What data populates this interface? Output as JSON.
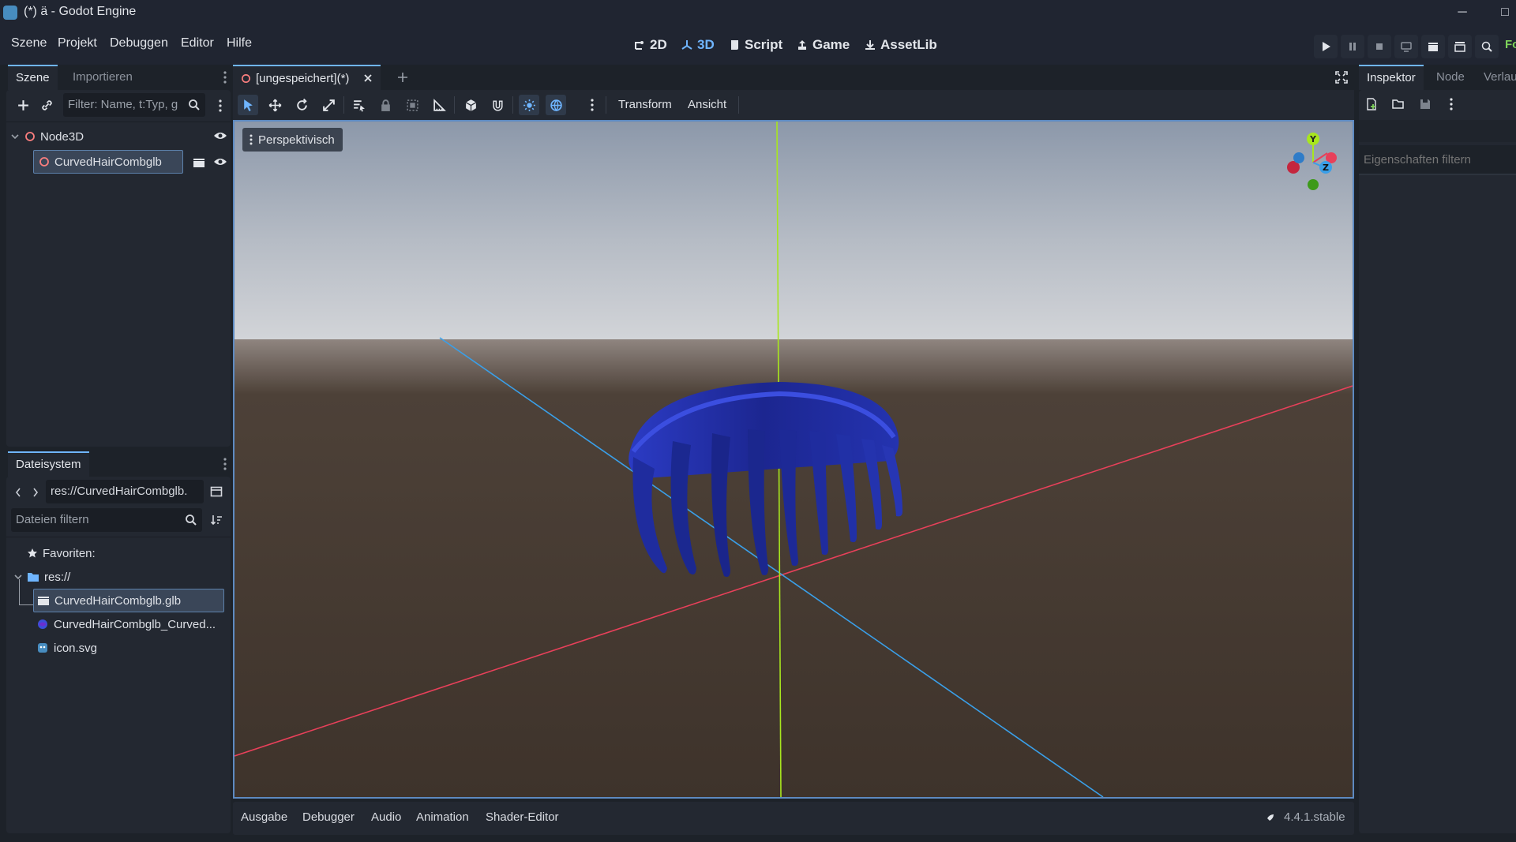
{
  "window": {
    "title": "(*) ä - Godot Engine",
    "minimize_glyph": "─",
    "maximize_glyph": "□"
  },
  "menu": {
    "items": [
      "Szene",
      "Projekt",
      "Debuggen",
      "Editor",
      "Hilfe"
    ]
  },
  "workspaces": {
    "tabs": [
      {
        "label": "2D",
        "icon": "2d-icon",
        "active": false
      },
      {
        "label": "3D",
        "icon": "3d-icon",
        "active": true
      },
      {
        "label": "Script",
        "icon": "script-icon",
        "active": false
      },
      {
        "label": "Game",
        "icon": "game-icon",
        "active": false
      },
      {
        "label": "AssetLib",
        "icon": "assetlib-icon",
        "active": false
      }
    ]
  },
  "run_controls": {
    "truncated_label": "Fo"
  },
  "scene_dock": {
    "tabs": [
      "Szene",
      "Importieren"
    ],
    "filter_placeholder": "Filter: Name, t:Typ, g",
    "nodes": [
      {
        "name": "Node3D",
        "type": "node3d-icon"
      },
      {
        "name": "CurvedHairCombglb",
        "type": "node3d-icon"
      }
    ]
  },
  "filesystem_dock": {
    "tab": "Dateisystem",
    "path": "res://CurvedHairCombglb.",
    "filter_placeholder": "Dateien filtern",
    "favorites": "Favoriten:",
    "root": "res://",
    "files": [
      {
        "name": "CurvedHairCombglb.glb",
        "icon": "scene-file-icon",
        "selected": true
      },
      {
        "name": "CurvedHairCombglb_Curved...",
        "icon": "material-file-icon",
        "selected": false
      },
      {
        "name": "icon.svg",
        "icon": "image-file-icon",
        "selected": false
      }
    ]
  },
  "editor": {
    "scene_tab": "[ungespeichert](*)",
    "toolbar_menus": [
      "Transform",
      "Ansicht"
    ],
    "viewport_mode": "Perspektivisch",
    "gizmo_labels": {
      "y": "Y",
      "z": "Z"
    }
  },
  "bottom_panel": {
    "tabs": [
      "Ausgabe",
      "Debugger",
      "Audio",
      "Animation",
      "Shader-Editor"
    ],
    "version": "4.4.1.stable"
  },
  "inspector_dock": {
    "tabs": [
      "Inspektor",
      "Node",
      "Verlau"
    ],
    "filter_placeholder": "Eigenschaften filtern"
  },
  "colors": {
    "accent": "#6fb5ff",
    "x_axis": "#e8405a",
    "y_axis": "#a8e61e",
    "z_axis": "#3a9fe8",
    "mesh": "#1e2a9c",
    "run_text": "#7dd35a"
  }
}
